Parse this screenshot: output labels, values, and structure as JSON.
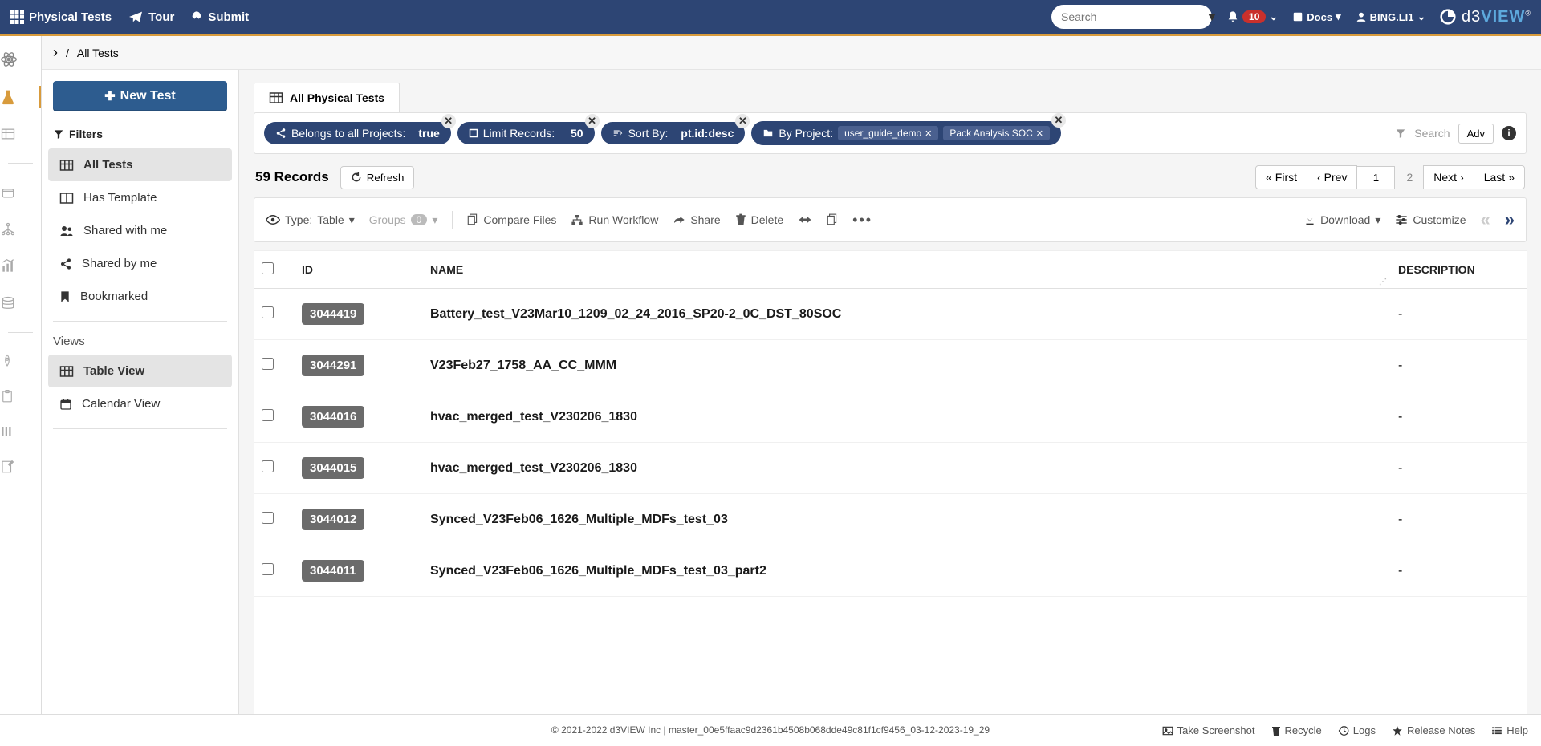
{
  "topbar": {
    "title": "Physical Tests",
    "tour": "Tour",
    "submit": "Submit",
    "search_placeholder": "Search",
    "notif_count": "10",
    "docs": "Docs",
    "user": "BING.LI1",
    "logo_d3": "d3",
    "logo_view": "VIEW"
  },
  "breadcrumb": {
    "current": "All Tests"
  },
  "sidebar": {
    "new_test": "New Test",
    "filters_label": "Filters",
    "filters": [
      {
        "label": "All Tests",
        "active": true
      },
      {
        "label": "Has Template"
      },
      {
        "label": "Shared with me"
      },
      {
        "label": "Shared by me"
      },
      {
        "label": "Bookmarked"
      }
    ],
    "views_label": "Views",
    "views": [
      {
        "label": "Table View",
        "active": true
      },
      {
        "label": "Calendar View"
      }
    ]
  },
  "tab": {
    "label": "All Physical Tests"
  },
  "chips": {
    "belongs_label": "Belongs to all Projects:",
    "belongs_value": "true",
    "limit_label": "Limit Records:",
    "limit_value": "50",
    "sort_label": "Sort By:",
    "sort_value": "pt.id:desc",
    "project_label": "By Project:",
    "project_tags": [
      "user_guide_demo",
      "Pack Analysis SOC"
    ],
    "search_label": "Search",
    "adv": "Adv"
  },
  "records": {
    "count": "59",
    "count_label": "Records",
    "refresh": "Refresh"
  },
  "pager": {
    "first": "First",
    "prev": "Prev",
    "current": "1",
    "total": "2",
    "next": "Next",
    "last": "Last"
  },
  "toolbar": {
    "type_label": "Type:",
    "type_value": "Table",
    "groups_label": "Groups",
    "groups_count": "0",
    "compare": "Compare Files",
    "workflow": "Run Workflow",
    "share": "Share",
    "delete": "Delete",
    "download": "Download",
    "customize": "Customize"
  },
  "table": {
    "headers": {
      "id": "ID",
      "name": "NAME",
      "description": "DESCRIPTION"
    },
    "rows": [
      {
        "id": "3044419",
        "name": "Battery_test_V23Mar10_1209_02_24_2016_SP20-2_0C_DST_80SOC",
        "desc": "-"
      },
      {
        "id": "3044291",
        "name": "V23Feb27_1758_AA_CC_MMM",
        "desc": "-"
      },
      {
        "id": "3044016",
        "name": "hvac_merged_test_V230206_1830",
        "desc": "-"
      },
      {
        "id": "3044015",
        "name": "hvac_merged_test_V230206_1830",
        "desc": "-"
      },
      {
        "id": "3044012",
        "name": "Synced_V23Feb06_1626_Multiple_MDFs_test_03",
        "desc": "-"
      },
      {
        "id": "3044011",
        "name": "Synced_V23Feb06_1626_Multiple_MDFs_test_03_part2",
        "desc": "-"
      }
    ]
  },
  "footer": {
    "copyright": "© 2021-2022 d3VIEW Inc | master_00e5ffaac9d2361b4508b068dde49c81f1cf9456_03-12-2023-19_29",
    "screenshot": "Take Screenshot",
    "recycle": "Recycle",
    "logs": "Logs",
    "release": "Release Notes",
    "help": "Help"
  }
}
